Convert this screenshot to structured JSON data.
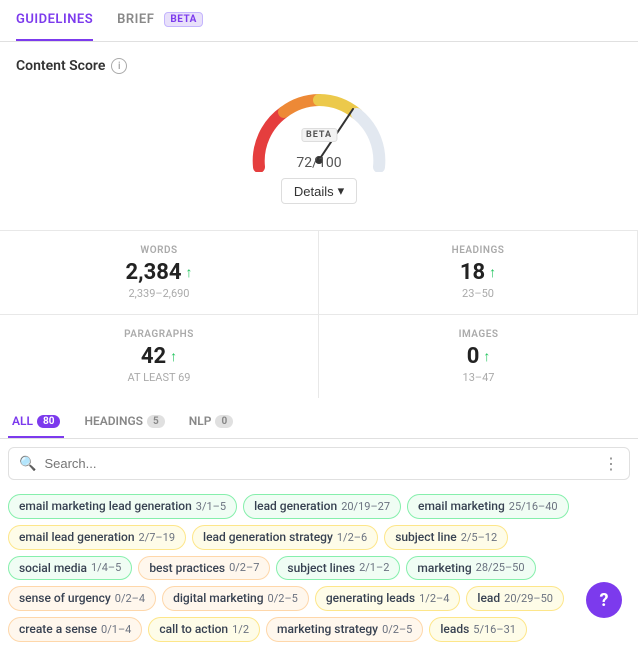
{
  "tabs": {
    "guidelines": {
      "label": "GUIDELINES",
      "active": true
    },
    "brief": {
      "label": "BRIEF",
      "active": false
    },
    "beta_badge": "BETA"
  },
  "content_score": {
    "title": "Content Score",
    "score": "72",
    "max": "/100",
    "beta_label": "BETA",
    "details_button": "Details"
  },
  "stats": {
    "words": {
      "label": "WORDS",
      "value": "2,384",
      "range": "2,339–2,690",
      "trend": "up"
    },
    "headings": {
      "label": "HEADINGS",
      "value": "18",
      "range": "23–50",
      "trend": "up"
    },
    "paragraphs": {
      "label": "PARAGRAPHS",
      "value": "42",
      "range": "AT LEAST 69",
      "trend": "up"
    },
    "images": {
      "label": "IMAGES",
      "value": "0",
      "range": "13–47",
      "trend": "up"
    }
  },
  "tag_tabs": [
    {
      "label": "ALL",
      "count": "80",
      "active": true
    },
    {
      "label": "HEADINGS",
      "count": "5",
      "active": false
    },
    {
      "label": "NLP",
      "count": "0",
      "active": false
    }
  ],
  "search": {
    "placeholder": "Search..."
  },
  "tags": [
    {
      "name": "email marketing lead generation",
      "score": "3/1–5",
      "color": "green"
    },
    {
      "name": "lead generation",
      "score": "20/19–27",
      "color": "green"
    },
    {
      "name": "email marketing",
      "score": "25/16–40",
      "color": "green"
    },
    {
      "name": "email lead generation",
      "score": "2/7–19",
      "color": "yellow"
    },
    {
      "name": "lead generation strategy",
      "score": "1/2–6",
      "color": "yellow"
    },
    {
      "name": "subject line",
      "score": "2/5–12",
      "color": "yellow"
    },
    {
      "name": "social media",
      "score": "1/4–5",
      "color": "green"
    },
    {
      "name": "best practices",
      "score": "0/2–7",
      "color": "orange"
    },
    {
      "name": "subject lines",
      "score": "2/1–2",
      "color": "green"
    },
    {
      "name": "marketing",
      "score": "28/25–50",
      "color": "green"
    },
    {
      "name": "sense of urgency",
      "score": "0/2–4",
      "color": "orange"
    },
    {
      "name": "digital marketing",
      "score": "0/2–5",
      "color": "orange"
    },
    {
      "name": "generating leads",
      "score": "1/2–4",
      "color": "yellow"
    },
    {
      "name": "lead",
      "score": "20/29–50",
      "color": "yellow"
    },
    {
      "name": "create a sense",
      "score": "0/1–4",
      "color": "orange"
    },
    {
      "name": "call to action",
      "score": "1/2",
      "color": "yellow"
    },
    {
      "name": "marketing strategy",
      "score": "0/2–5",
      "color": "orange"
    },
    {
      "name": "leads",
      "score": "5/16–31",
      "color": "yellow"
    }
  ]
}
